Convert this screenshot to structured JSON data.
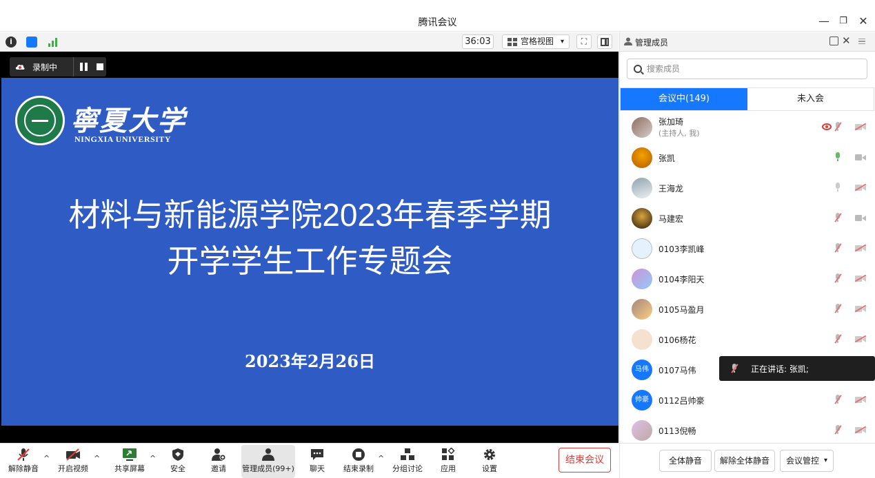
{
  "window": {
    "title": "腾讯会议",
    "minimize": "—",
    "restore": "❐",
    "close": "✕"
  },
  "statusbar": {
    "timer": "36:03",
    "view_label": "宫格视图",
    "view_caret": "▾"
  },
  "recording": {
    "label": "录制中"
  },
  "slide": {
    "university_cn": "寧夏大学",
    "university_en": "NINGXIA UNIVERSITY",
    "title_line1": "材料与新能源学院2023年春季学期",
    "title_line2": "开学学生工作专题会",
    "date": "2023年2月26日"
  },
  "toolbar": {
    "items": [
      {
        "label": "解除静音"
      },
      {
        "label": "开启视频"
      },
      {
        "label": "共享屏幕"
      },
      {
        "label": "安全"
      },
      {
        "label": "邀请"
      },
      {
        "label": "管理成员(99+)"
      },
      {
        "label": "聊天"
      },
      {
        "label": "结束录制"
      },
      {
        "label": "分组讨论"
      },
      {
        "label": "应用"
      },
      {
        "label": "设置"
      }
    ],
    "caret": "^",
    "end_meeting": "结束会议"
  },
  "panel": {
    "title": "管理成员",
    "search_placeholder": "搜索成员",
    "tab_in_meeting": "会议中(149)",
    "tab_not_joined": "未入会",
    "members": [
      {
        "name": "张加琦",
        "sub": "(主持人, 我)"
      },
      {
        "name": "张凯"
      },
      {
        "name": "王海龙"
      },
      {
        "name": "马建宏"
      },
      {
        "name": "0103李凯峰"
      },
      {
        "name": "0104李阳天"
      },
      {
        "name": "0105马盈月"
      },
      {
        "name": "0106杨花"
      },
      {
        "name": "0107马伟",
        "avatar_text": "马伟"
      },
      {
        "name": "0112吕帅豪",
        "avatar_text": "帅豪"
      },
      {
        "name": "0113倪畅"
      }
    ],
    "speaking": "正在讲话: 张凯;",
    "mute_all": "全体静音",
    "unmute_all": "解除全体静音",
    "meeting_control": "会议管控",
    "meeting_control_caret": "▾"
  },
  "colors": {
    "slide_bg": "#2f5bc4",
    "accent": "#1677ff",
    "danger": "#e53935",
    "muted_red": "#e57373",
    "mic_green": "#4caf50"
  }
}
